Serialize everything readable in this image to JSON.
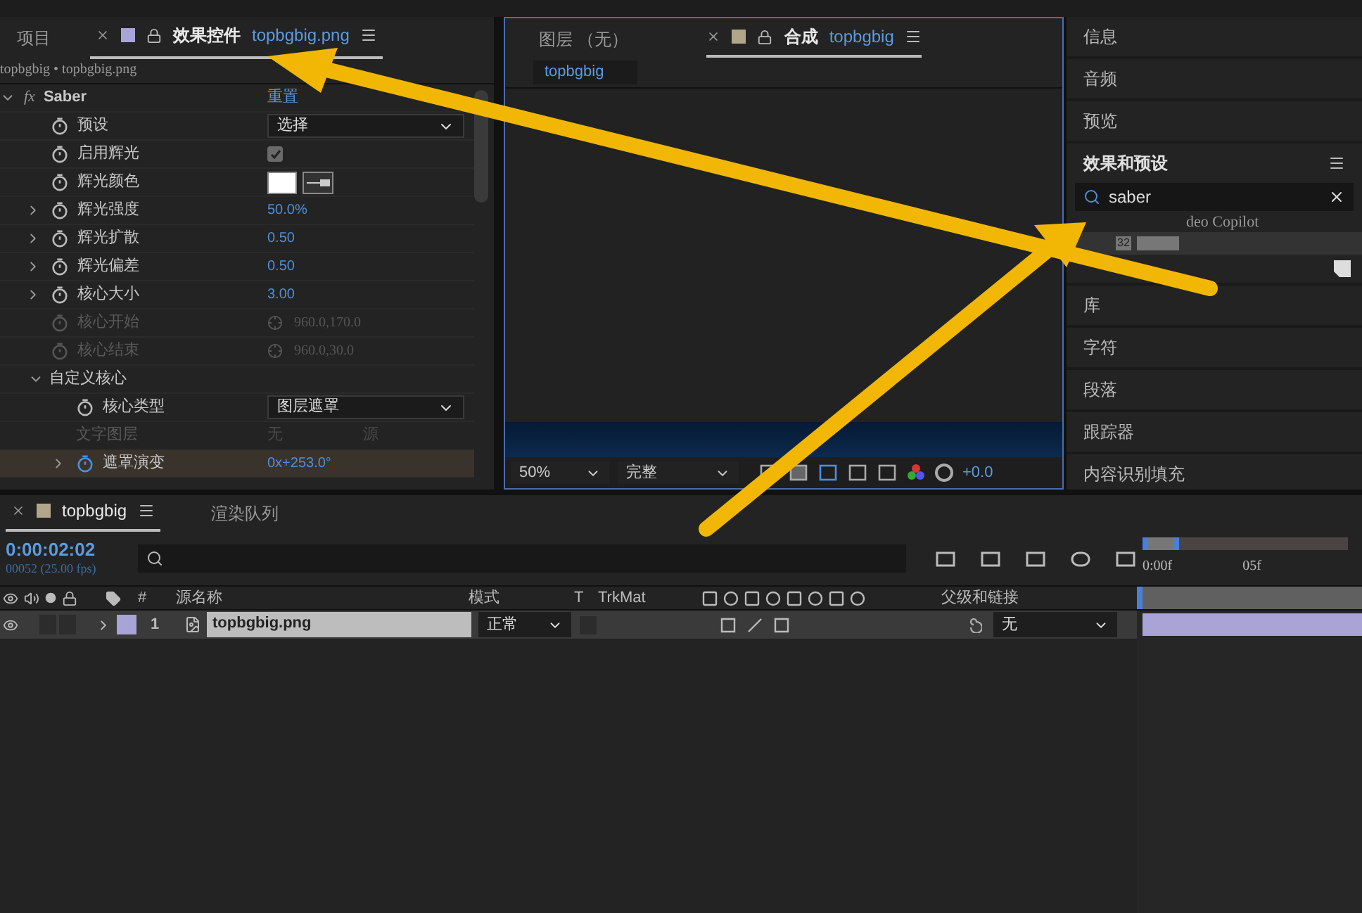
{
  "effect_controls": {
    "tabs": [
      {
        "label": "项目",
        "selected": false
      },
      {
        "label": "效果控件",
        "file": "topbgbig.png",
        "selected": true
      }
    ],
    "breadcrumb": "topbgbig • topbgbig.png",
    "effect": {
      "icon_label": "fx",
      "name": "Saber",
      "reset": "重置",
      "expanded": true
    },
    "rows": [
      {
        "kind": "dropdown",
        "label": "预设",
        "value": "选择",
        "expandable": false,
        "disabled": false
      },
      {
        "kind": "checkbox",
        "label": "启用辉光",
        "checked": true,
        "expandable": false,
        "disabled": false
      },
      {
        "kind": "color",
        "label": "辉光颜色",
        "color": "#ffffff",
        "expandable": false,
        "disabled": false
      },
      {
        "kind": "number",
        "label": "辉光强度",
        "value": "50.0%",
        "expandable": true,
        "disabled": false
      },
      {
        "kind": "number",
        "label": "辉光扩散",
        "value": "0.50",
        "expandable": true,
        "disabled": false
      },
      {
        "kind": "number",
        "label": "辉光偏差",
        "value": "0.50",
        "expandable": true,
        "disabled": false
      },
      {
        "kind": "number",
        "label": "核心大小",
        "value": "3.00",
        "expandable": true,
        "disabled": false
      },
      {
        "kind": "point",
        "label": "核心开始",
        "value": "960.0,170.0",
        "expandable": false,
        "disabled": true
      },
      {
        "kind": "point",
        "label": "核心结束",
        "value": "960.0,30.0",
        "expandable": false,
        "disabled": true
      },
      {
        "kind": "group",
        "label": "自定义核心",
        "expanded": true,
        "children": [
          {
            "kind": "dropdown",
            "label": "核心类型",
            "value": "图层遮罩",
            "expandable": false,
            "disabled": false
          },
          {
            "kind": "pair",
            "label": "文字图层",
            "value": "无",
            "value2": "源",
            "expandable": false,
            "disabled": true
          },
          {
            "kind": "number",
            "label": "遮罩演变",
            "value": "0x+253.0°",
            "expandable": true,
            "disabled": false,
            "highlighted": true
          }
        ]
      }
    ]
  },
  "composition": {
    "tabs": [
      {
        "label": "图层 （无）",
        "selected": false
      },
      {
        "label": "合成",
        "file": "topbgbig",
        "selected": true
      }
    ],
    "layer_button": "topbgbig",
    "zoom": "50%",
    "resolution": "完整",
    "exposure": "+0.0"
  },
  "side_panels": [
    {
      "label": "信息",
      "expanded": false
    },
    {
      "label": "音频",
      "expanded": false
    },
    {
      "label": "预览",
      "expanded": false
    },
    {
      "label": "效果和预设",
      "expanded": true,
      "search": "saber",
      "vendor": "deo Copilot",
      "item_badge": "32"
    },
    {
      "label": "库",
      "expanded": false
    },
    {
      "label": "字符",
      "expanded": false
    },
    {
      "label": "段落",
      "expanded": false
    },
    {
      "label": "跟踪器",
      "expanded": false
    },
    {
      "label": "内容识别填充",
      "expanded": false
    }
  ],
  "timeline": {
    "tabs": [
      {
        "label": "topbgbig",
        "selected": true
      },
      {
        "label": "渲染队列",
        "selected": false
      }
    ],
    "timecode": "0:00:02:02",
    "frame_info": "00052 (25.00 fps)",
    "columns": [
      "#",
      "源名称",
      "模式",
      "T",
      "TrkMat",
      "父级和链接"
    ],
    "ruler": [
      "0:00f",
      "05f"
    ],
    "layers": [
      {
        "number": "1",
        "name": "topbgbig.png",
        "mode": "正常",
        "parent": "无",
        "color": "#a9a3d6",
        "selected": true,
        "visible": true
      }
    ]
  }
}
